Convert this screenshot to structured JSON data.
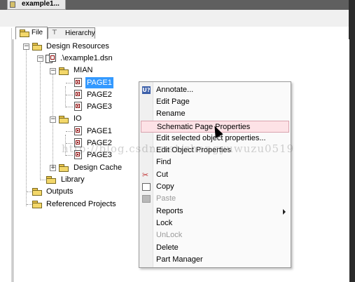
{
  "window": {
    "doc_tab": "example1..."
  },
  "tabs": [
    {
      "label": "File",
      "icon": "folder-icon",
      "active": true
    },
    {
      "label": "Hierarchy",
      "icon": "hierarchy-icon",
      "active": false
    }
  ],
  "tree": {
    "root": "Design Resources",
    "dsn": ".\\example1.dsn",
    "folder_mian": "MIAN",
    "mian_pages": [
      "PAGE1",
      "PAGE2",
      "PAGE3"
    ],
    "folder_io": "IO",
    "io_pages": [
      "PAGE1",
      "PAGE2",
      "PAGE3"
    ],
    "design_cache": "Design Cache",
    "library": "Library",
    "outputs": "Outputs",
    "referenced_projects": "Referenced Projects",
    "selected": "PAGE1"
  },
  "context_menu": {
    "items": [
      {
        "label": "Annotate...",
        "icon": "annotate-icon"
      },
      {
        "label": "Edit Page"
      },
      {
        "label": "Rename"
      },
      {
        "label": "Schematic Page Properties",
        "highlighted": true
      },
      {
        "label": "Edit selected object properties..."
      },
      {
        "label": "Edit Object Properties"
      },
      {
        "label": "Find"
      },
      {
        "label": "Cut",
        "icon": "scissors-icon"
      },
      {
        "label": "Copy",
        "icon": "copy-icon"
      },
      {
        "label": "Paste",
        "icon": "paste-icon",
        "disabled": true
      },
      {
        "label": "Reports",
        "submenu": true
      },
      {
        "label": "Lock"
      },
      {
        "label": "UnLock",
        "disabled": true
      },
      {
        "label": "Delete"
      },
      {
        "label": "Part Manager"
      }
    ]
  },
  "watermark": "http://blog.csdn.net/zhangyuwuzu0519",
  "colors": {
    "selection": "#3399ff",
    "menu_highlight": "#fde2e6",
    "folder": "#f3d76a"
  }
}
